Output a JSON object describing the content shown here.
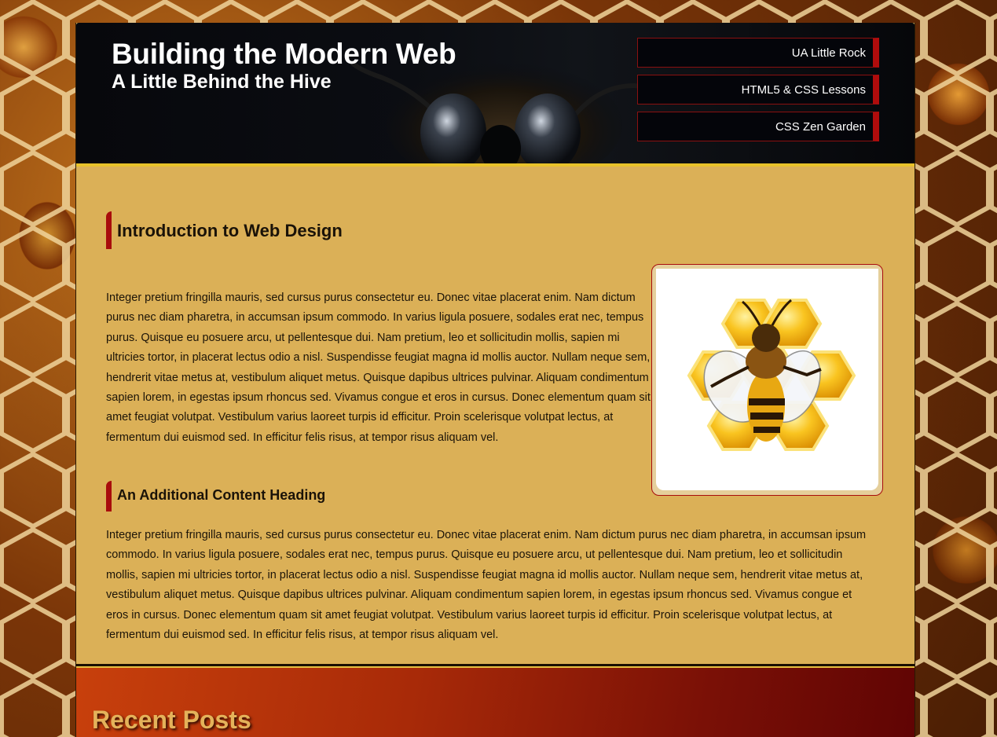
{
  "header": {
    "title": "Building the Modern Web",
    "subtitle": "A Little Behind the Hive"
  },
  "nav": {
    "items": [
      {
        "label": "UA Little Rock"
      },
      {
        "label": "HTML5 & CSS Lessons"
      },
      {
        "label": "CSS Zen Garden"
      }
    ]
  },
  "main": {
    "heading": "Introduction to Web Design",
    "paragraph1": "Integer pretium fringilla mauris, sed cursus purus consectetur eu. Donec vitae placerat enim. Nam dictum purus nec diam pharetra, in accumsan ipsum commodo. In varius ligula posuere, sodales erat nec, tempus purus. Quisque eu posuere arcu, ut pellentesque dui. Nam pretium, leo et sollicitudin mollis, sapien mi ultricies tortor, in placerat lectus odio a nisl. Suspendisse feugiat magna id mollis auctor. Nullam neque sem, hendrerit vitae metus at, vestibulum aliquet metus. Quisque dapibus ultrices pulvinar. Aliquam condimentum sapien lorem, in egestas ipsum rhoncus sed. Vivamus congue et eros in cursus. Donec elementum quam sit amet feugiat volutpat. Vestibulum varius laoreet turpis id efficitur. Proin scelerisque volutpat lectus, at fermentum dui euismod sed. In efficitur felis risus, at tempor risus aliquam vel.",
    "subheading": "An Additional Content Heading",
    "paragraph2": "Integer pretium fringilla mauris, sed cursus purus consectetur eu. Donec vitae placerat enim. Nam dictum purus nec diam pharetra, in accumsan ipsum commodo. In varius ligula posuere, sodales erat nec, tempus purus. Quisque eu posuere arcu, ut pellentesque dui. Nam pretium, leo et sollicitudin mollis, sapien mi ultricies tortor, in placerat lectus odio a nisl. Suspendisse feugiat magna id mollis auctor. Nullam neque sem, hendrerit vitae metus at, vestibulum aliquet metus. Quisque dapibus ultrices pulvinar. Aliquam condimentum sapien lorem, in egestas ipsum rhoncus sed. Vivamus congue et eros in cursus. Donec elementum quam sit amet feugiat volutpat. Vestibulum varius laoreet turpis id efficitur. Proin scelerisque volutpat lectus, at fermentum dui euismod sed. In efficitur felis risus, at tempor risus aliquam vel.",
    "image_icon": "bee-on-honeycomb-icon"
  },
  "footer": {
    "recent_posts_title": "Recent Posts"
  },
  "colors": {
    "page_background": "#dbb057",
    "header_background": "#07080c",
    "header_border": "#e8c22a",
    "accent_red": "#a80c0c",
    "footer_orange": "#c8400c",
    "footer_title": "#e4b25a"
  }
}
